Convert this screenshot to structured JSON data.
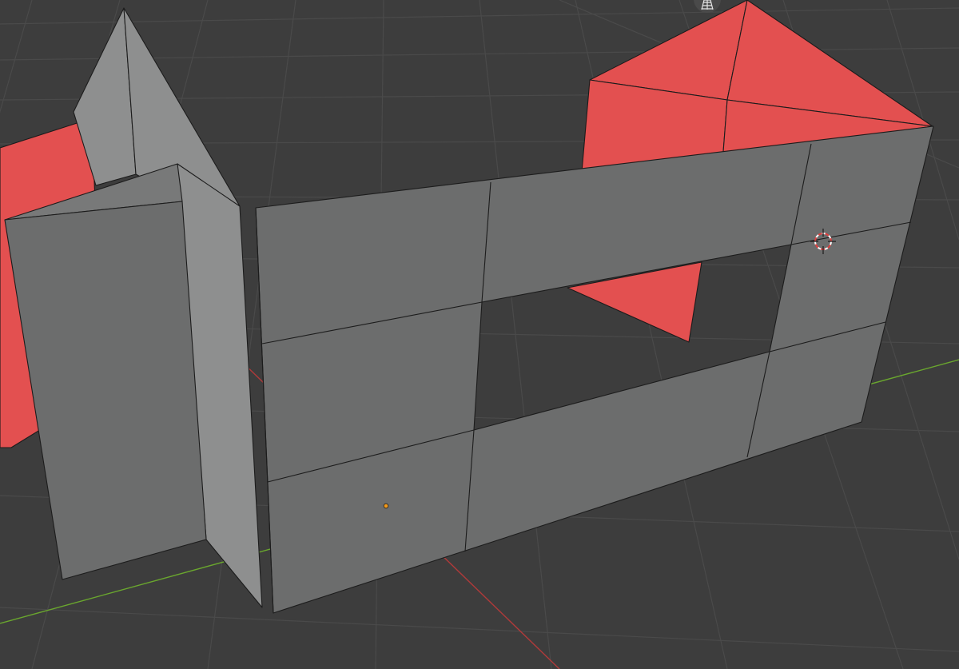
{
  "viewport": {
    "background": "#3d3d3d",
    "grid_color": "#4a4a4a",
    "x_axis_color": "#b03a3a",
    "y_axis_color": "#6aa72e"
  },
  "scene": {
    "face_color": "#6c6d6d",
    "face_light_color": "#8e8f8f",
    "face_mid_color": "#787979",
    "selected_face_color": "#e35050",
    "edge_color": "#1c1c1c",
    "origin_color": "#f29a1b"
  },
  "overlay": {
    "grid_toggle_icon": "grid-perspective-icon",
    "cursor_icon": "3d-cursor-icon"
  }
}
